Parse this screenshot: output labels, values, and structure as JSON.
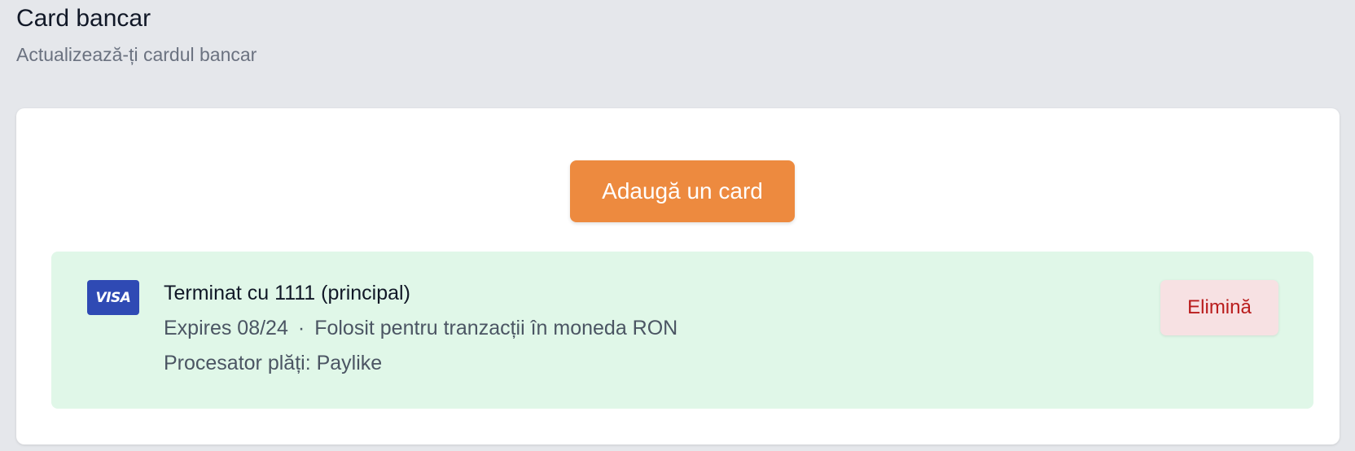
{
  "header": {
    "title": "Card bancar",
    "subtitle": "Actualizează-ți cardul bancar"
  },
  "actions": {
    "add_card_label": "Adaugă un card"
  },
  "card": {
    "brand": "VISA",
    "brand_icon": "visa-card-icon",
    "title": "Terminat cu 1111 (principal)",
    "expires": "Expires 08/24",
    "separator": "·",
    "usage": "Folosit pentru tranzacții în moneda RON",
    "processor": "Procesator plăți: Paylike",
    "remove_label": "Elimină"
  },
  "colors": {
    "accent": "#ED8A3F",
    "card_background": "#E0F7E8",
    "visa_blue": "#2F4AB4",
    "danger_text": "#B91C1C",
    "danger_background": "#F7E1E3"
  }
}
